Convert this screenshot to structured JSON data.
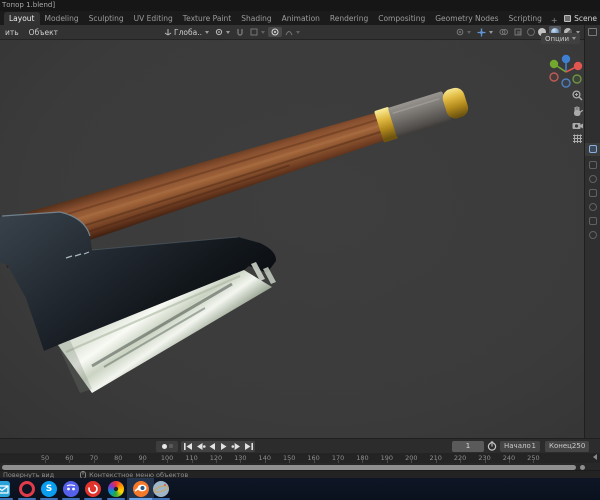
{
  "window": {
    "title_fragment": "Топор 1.blend]"
  },
  "workspace": {
    "tabs": [
      {
        "label": "Layout",
        "active": true
      },
      {
        "label": "Modeling"
      },
      {
        "label": "Sculpting"
      },
      {
        "label": "UV Editing"
      },
      {
        "label": "Texture Paint"
      },
      {
        "label": "Shading"
      },
      {
        "label": "Animation"
      },
      {
        "label": "Rendering"
      },
      {
        "label": "Compositing"
      },
      {
        "label": "Geometry Nodes"
      },
      {
        "label": "Scripting"
      }
    ],
    "new_tab_label": "+",
    "scene_label": "Scene"
  },
  "viewport_header": {
    "menu_fragment": "ить",
    "menu_object": "Объект",
    "orientation_label": "Глоба..",
    "options_label": "Опции"
  },
  "timeline": {
    "current_frame": "1",
    "start_label": "Начало",
    "start_value": "1",
    "end_label": "Конец",
    "end_value": "250",
    "ruler_frames": [
      50,
      60,
      70,
      80,
      90,
      100,
      110,
      120,
      130,
      140,
      150,
      160,
      170,
      180,
      190,
      200,
      210,
      220,
      230,
      240,
      250
    ]
  },
  "status_bar": {
    "left_hint": "Повернуть вид",
    "right_hint": "Контекстное меню объектов"
  },
  "taskbar": {
    "apps": [
      "mail",
      "opera",
      "skype",
      "discord",
      "red-app",
      "color-wheel",
      "blender",
      "planet"
    ],
    "active_app": "blender"
  },
  "scene_model": "axe with wooden handle, gold rings, dark steel head with polished blade",
  "icons": {
    "navigation_gizmo": "xyz-axis-balls",
    "zoom-icon": "magnifier",
    "pan-icon": "hand",
    "camera-view-icon": "camera",
    "ortho-grid-icon": "grid",
    "snap-icon": "magnet",
    "stopwatch-icon": "clock",
    "mouse-icon": "mouse"
  },
  "colors": {
    "axis_x": "#e3554f",
    "axis_y": "#73a82e",
    "axis_z": "#3f7fd0",
    "gold": "#d9b13a",
    "wood": "#8a5130",
    "steel_dark": "#14191e",
    "blade_bright": "#f2f5ee",
    "taskbar_accent": "#3f6fb5",
    "header_bg": "#323232",
    "viewport_bg": "#3c3c3c"
  }
}
